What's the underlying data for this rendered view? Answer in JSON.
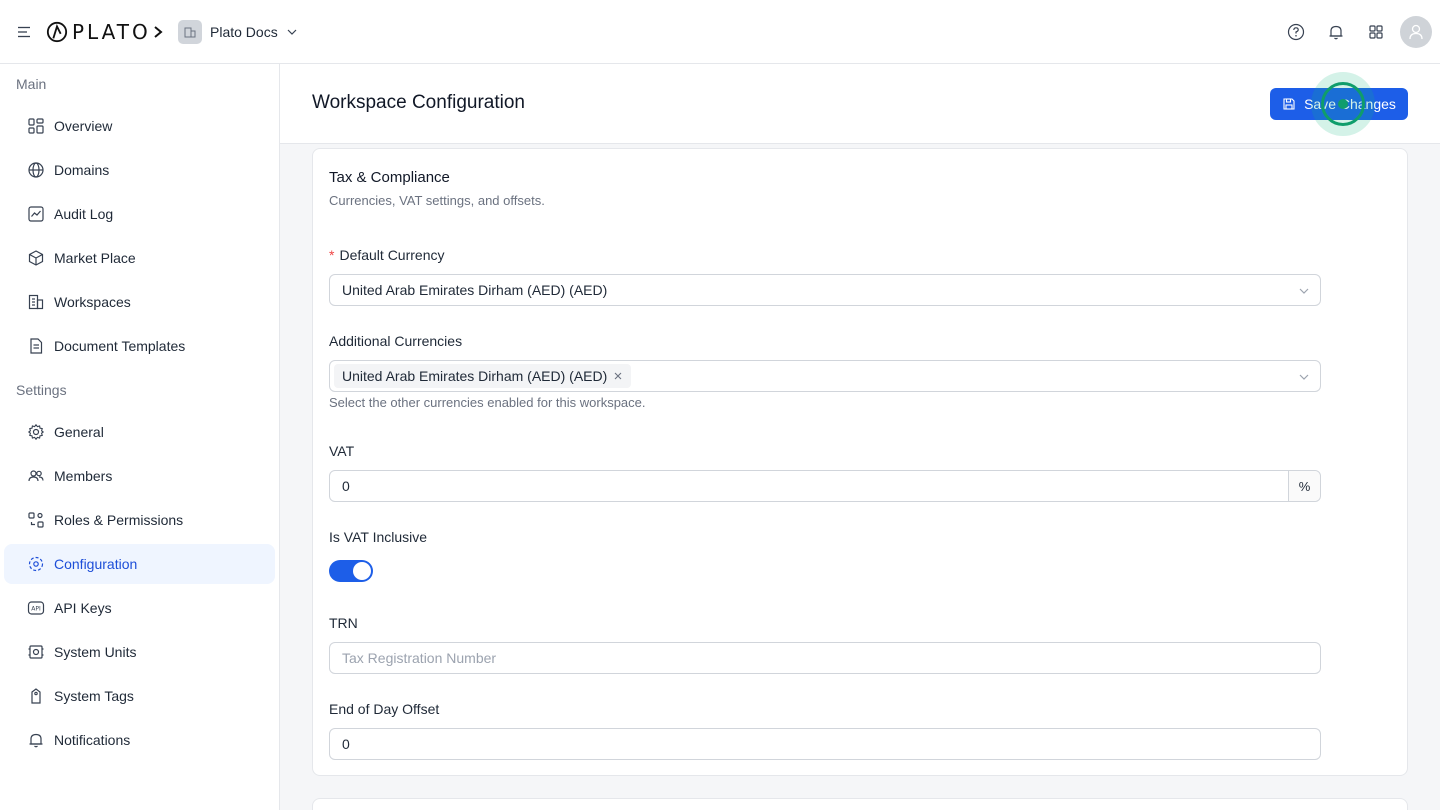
{
  "topbar": {
    "logo_text": "PLATO",
    "workspace_name": "Plato Docs"
  },
  "sidebar": {
    "main_label": "Main",
    "main_items": [
      {
        "label": "Overview",
        "icon": "grid-icon"
      },
      {
        "label": "Domains",
        "icon": "globe-icon"
      },
      {
        "label": "Audit Log",
        "icon": "chart-icon"
      },
      {
        "label": "Market Place",
        "icon": "cube-icon"
      },
      {
        "label": "Workspaces",
        "icon": "building-icon"
      },
      {
        "label": "Document Templates",
        "icon": "document-icon"
      }
    ],
    "settings_label": "Settings",
    "settings_items": [
      {
        "label": "General",
        "icon": "gear-icon"
      },
      {
        "label": "Members",
        "icon": "users-icon"
      },
      {
        "label": "Roles & Permissions",
        "icon": "roles-icon"
      },
      {
        "label": "Configuration",
        "icon": "config-icon",
        "active": true
      },
      {
        "label": "API Keys",
        "icon": "api-icon"
      },
      {
        "label": "System Units",
        "icon": "units-icon"
      },
      {
        "label": "System Tags",
        "icon": "tag-icon"
      },
      {
        "label": "Notifications",
        "icon": "bell-icon"
      }
    ]
  },
  "header": {
    "title": "Workspace Configuration",
    "save_label": "Save Changes"
  },
  "tax_card": {
    "title": "Tax & Compliance",
    "subtitle": "Currencies, VAT settings, and offsets.",
    "default_currency_label": "Default Currency",
    "default_currency_value": "United Arab Emirates Dirham (AED) (AED)",
    "additional_currencies_label": "Additional Currencies",
    "additional_currencies_tags": [
      "United Arab Emirates Dirham (AED) (AED)"
    ],
    "additional_currencies_help": "Select the other currencies enabled for this workspace.",
    "vat_label": "VAT",
    "vat_value": "0",
    "vat_suffix": "%",
    "vat_inclusive_label": "Is VAT Inclusive",
    "vat_inclusive_on": true,
    "trn_label": "TRN",
    "trn_value": "",
    "trn_placeholder": "Tax Registration Number",
    "eod_label": "End of Day Offset",
    "eod_value": "0"
  },
  "colors": {
    "accent": "#1d5ee8",
    "active_bg": "#eff5ff",
    "click_indicator": "#0f9d6b"
  }
}
